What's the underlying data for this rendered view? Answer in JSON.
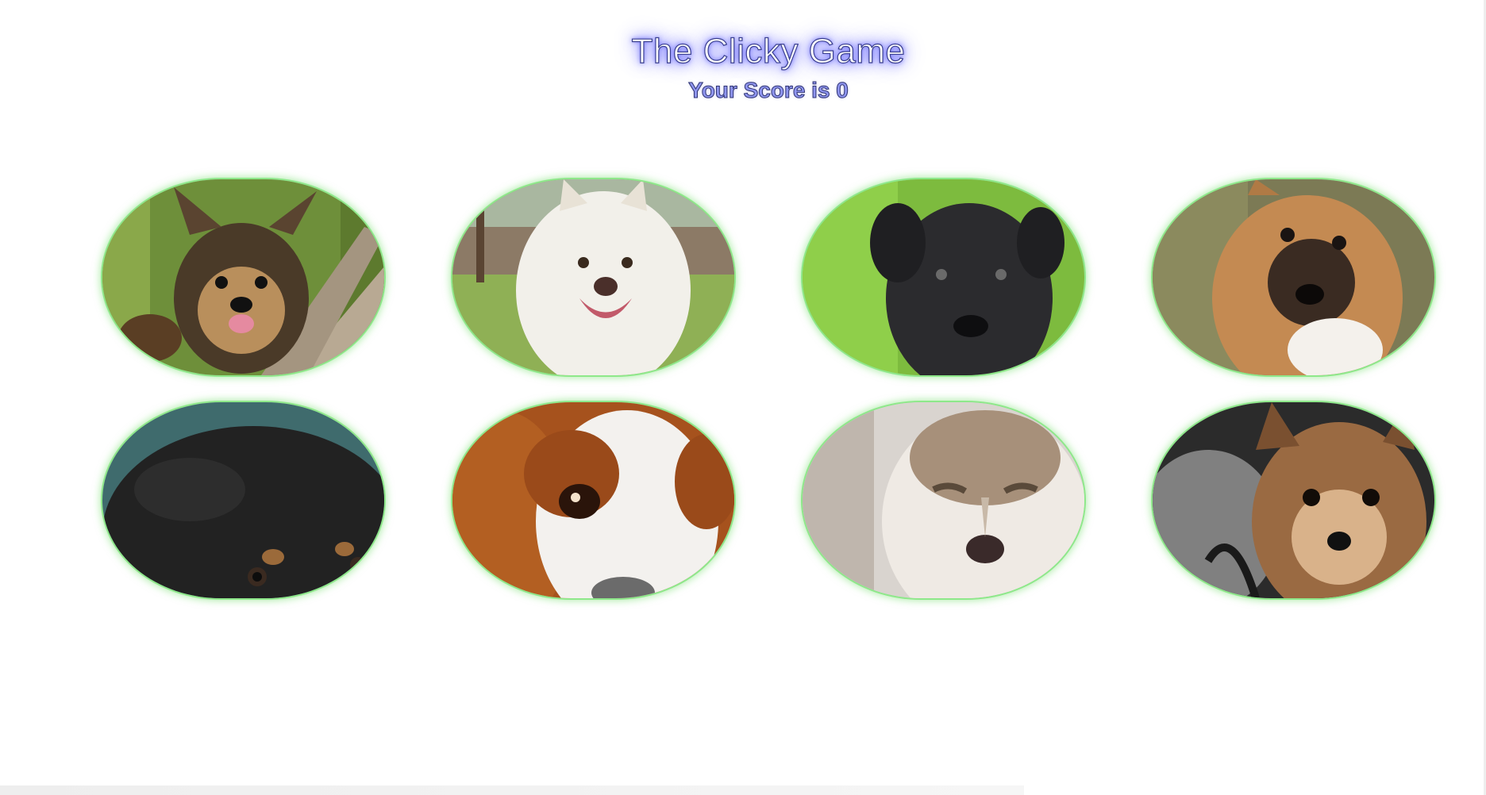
{
  "game": {
    "title": "The Clicky Game",
    "score_text": "Your Score is 0",
    "score": 0
  },
  "theme": {
    "title_glow": "#7b7bff",
    "score_color": "#8f95f0",
    "card_border": "#8ee88a"
  },
  "cards": [
    {
      "id": 1,
      "subject": "yorkshire-terrier-puppy",
      "bg": "#6e8f3a",
      "fur": "#4a3a28",
      "accent": "#c59a62"
    },
    {
      "id": 2,
      "subject": "white-fluffy-puppy",
      "bg": "#7a9a4c",
      "fur": "#f2f0ea",
      "accent": "#d9d2c4"
    },
    {
      "id": 3,
      "subject": "black-labrador-puppy",
      "bg": "#7dbb3e",
      "fur": "#2b2b2e",
      "accent": "#444448"
    },
    {
      "id": 4,
      "subject": "tan-mixed-puppy",
      "bg": "#7c7a55",
      "fur": "#c48a52",
      "accent": "#2a211c"
    },
    {
      "id": 5,
      "subject": "black-tan-dog",
      "bg": "#3f6b6d",
      "fur": "#222222",
      "accent": "#9b6a3a"
    },
    {
      "id": 6,
      "subject": "cavalier-spaniel",
      "bg": "#a6521d",
      "fur": "#f3f1ee",
      "accent": "#b35f22"
    },
    {
      "id": 7,
      "subject": "husky-puppy",
      "bg": "#d9d4cf",
      "fur": "#efeae4",
      "accent": "#a7907a"
    },
    {
      "id": 8,
      "subject": "chihuahua",
      "bg": "#2b2b2b",
      "fur": "#9a6a42",
      "accent": "#d9b28a"
    }
  ]
}
